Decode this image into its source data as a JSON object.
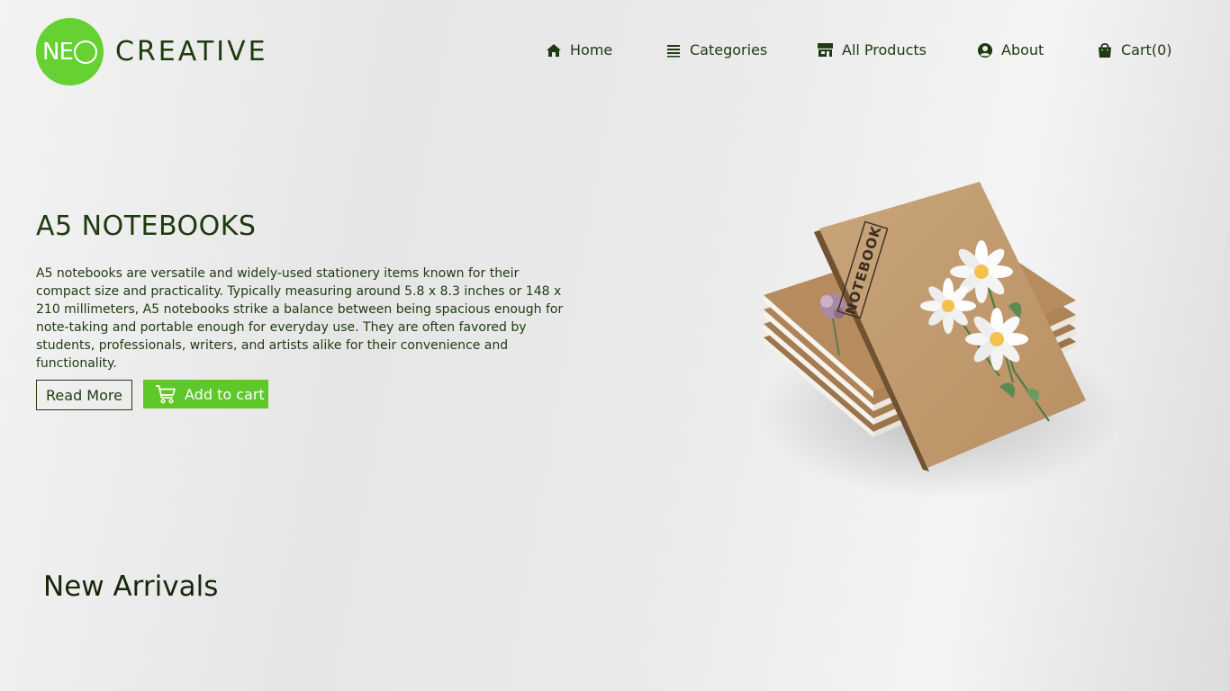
{
  "brand": {
    "logo_mark": "NE",
    "name": "CREATIVE",
    "color": "#65d133"
  },
  "nav": {
    "items": [
      {
        "label": "Home",
        "icon": "home-icon"
      },
      {
        "label": "Categories",
        "icon": "list-icon"
      },
      {
        "label": "All Products",
        "icon": "store-icon"
      },
      {
        "label": "About",
        "icon": "user-circle-icon"
      },
      {
        "label": "Cart(0)",
        "icon": "shopping-bag-icon"
      }
    ]
  },
  "hero": {
    "title": "A5 NOTEBOOKS",
    "description": "A5 notebooks are versatile and widely-used stationery items known for their compact size and practicality. Typically measuring around 5.8 x 8.3 inches or 148 x 210 millimeters, A5 notebooks strike a balance between being spacious enough for note-taking and portable enough for everyday use. They are often favored by students, professionals, writers, and artists alike for their convenience and functionality.",
    "read_more_label": "Read More",
    "add_to_cart_label": "Add to cart",
    "image_cover_text": "NOTEBOOK"
  },
  "sections": {
    "new_arrivals_title": "New Arrivals"
  },
  "colors": {
    "accent": "#5ec72a",
    "text": "#1e3a0f"
  }
}
